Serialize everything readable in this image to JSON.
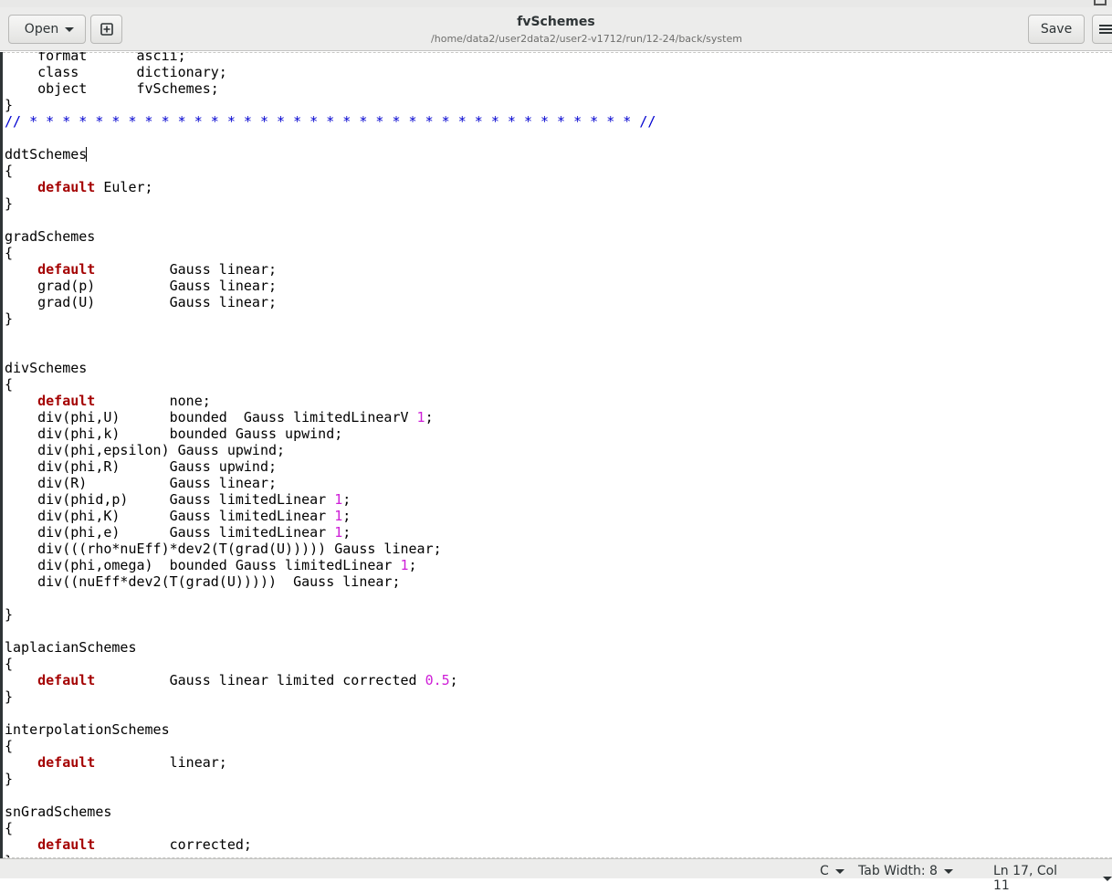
{
  "window": {
    "title": "fvSchemes",
    "subtitle": "/home/data2/user2data2/user2-v1712/run/12-24/back/system"
  },
  "toolbar": {
    "open_label": "Open",
    "save_label": "Save",
    "new_icon": "new-document-icon",
    "menu_icon": "hamburger-menu-icon"
  },
  "editor": {
    "lines": [
      [
        {
          "t": "    format      ascii;"
        }
      ],
      [
        {
          "t": "    class       dictionary;"
        }
      ],
      [
        {
          "t": "    object      fvSchemes;"
        }
      ],
      [
        {
          "t": "}"
        }
      ],
      [
        {
          "t": "// * * * * * * * * * * * * * * * * * * * * * * * * * * * * * * * * * * * * * //",
          "c": "cmt"
        }
      ],
      [
        {
          "t": ""
        }
      ],
      [
        {
          "t": "ddtSchemes"
        },
        {
          "cursor": true
        }
      ],
      [
        {
          "t": "{"
        }
      ],
      [
        {
          "t": "    "
        },
        {
          "t": "default",
          "c": "kw"
        },
        {
          "t": " Euler;"
        }
      ],
      [
        {
          "t": "}"
        }
      ],
      [
        {
          "t": ""
        }
      ],
      [
        {
          "t": "gradSchemes"
        }
      ],
      [
        {
          "t": "{"
        }
      ],
      [
        {
          "t": "    "
        },
        {
          "t": "default",
          "c": "kw"
        },
        {
          "t": "         Gauss linear;"
        }
      ],
      [
        {
          "t": "    grad(p)         Gauss linear;"
        }
      ],
      [
        {
          "t": "    grad(U)         Gauss linear;"
        }
      ],
      [
        {
          "t": "}"
        }
      ],
      [
        {
          "t": ""
        }
      ],
      [
        {
          "t": ""
        }
      ],
      [
        {
          "t": "divSchemes"
        }
      ],
      [
        {
          "t": "{"
        }
      ],
      [
        {
          "t": "    "
        },
        {
          "t": "default",
          "c": "kw"
        },
        {
          "t": "         none;"
        }
      ],
      [
        {
          "t": "    div(phi,U)      bounded  Gauss limitedLinearV "
        },
        {
          "t": "1",
          "c": "num"
        },
        {
          "t": ";"
        }
      ],
      [
        {
          "t": "    div(phi,k)      bounded Gauss upwind;"
        }
      ],
      [
        {
          "t": "    div(phi,epsilon) Gauss upwind;"
        }
      ],
      [
        {
          "t": "    div(phi,R)      Gauss upwind;"
        }
      ],
      [
        {
          "t": "    div(R)          Gauss linear;"
        }
      ],
      [
        {
          "t": "    div(phid,p)     Gauss limitedLinear "
        },
        {
          "t": "1",
          "c": "num"
        },
        {
          "t": ";"
        }
      ],
      [
        {
          "t": "    div(phi,K)      Gauss limitedLinear "
        },
        {
          "t": "1",
          "c": "num"
        },
        {
          "t": ";"
        }
      ],
      [
        {
          "t": "    div(phi,e)      Gauss limitedLinear "
        },
        {
          "t": "1",
          "c": "num"
        },
        {
          "t": ";"
        }
      ],
      [
        {
          "t": "    div(((rho*nuEff)*dev2(T(grad(U))))) Gauss linear;"
        }
      ],
      [
        {
          "t": "    div(phi,omega)  bounded Gauss limitedLinear "
        },
        {
          "t": "1",
          "c": "num"
        },
        {
          "t": ";"
        }
      ],
      [
        {
          "t": "    div((nuEff*dev2(T(grad(U)))))  Gauss linear;"
        }
      ],
      [
        {
          "t": ""
        }
      ],
      [
        {
          "t": "}"
        }
      ],
      [
        {
          "t": ""
        }
      ],
      [
        {
          "t": "laplacianSchemes"
        }
      ],
      [
        {
          "t": "{"
        }
      ],
      [
        {
          "t": "    "
        },
        {
          "t": "default",
          "c": "kw"
        },
        {
          "t": "         Gauss linear limited corrected "
        },
        {
          "t": "0.5",
          "c": "num"
        },
        {
          "t": ";"
        }
      ],
      [
        {
          "t": "}"
        }
      ],
      [
        {
          "t": ""
        }
      ],
      [
        {
          "t": "interpolationSchemes"
        }
      ],
      [
        {
          "t": "{"
        }
      ],
      [
        {
          "t": "    "
        },
        {
          "t": "default",
          "c": "kw"
        },
        {
          "t": "         linear;"
        }
      ],
      [
        {
          "t": "}"
        }
      ],
      [
        {
          "t": ""
        }
      ],
      [
        {
          "t": "snGradSchemes"
        }
      ],
      [
        {
          "t": "{"
        }
      ],
      [
        {
          "t": "    "
        },
        {
          "t": "default",
          "c": "kw"
        },
        {
          "t": "         corrected;"
        }
      ],
      [
        {
          "t": "}"
        }
      ]
    ]
  },
  "statusbar": {
    "language": "C",
    "tab_width": "Tab Width: 8",
    "position": "Ln 17, Col 11"
  },
  "colors": {
    "keyword": "#a40000",
    "number": "#ce1ed7",
    "comment": "#0000d0"
  }
}
